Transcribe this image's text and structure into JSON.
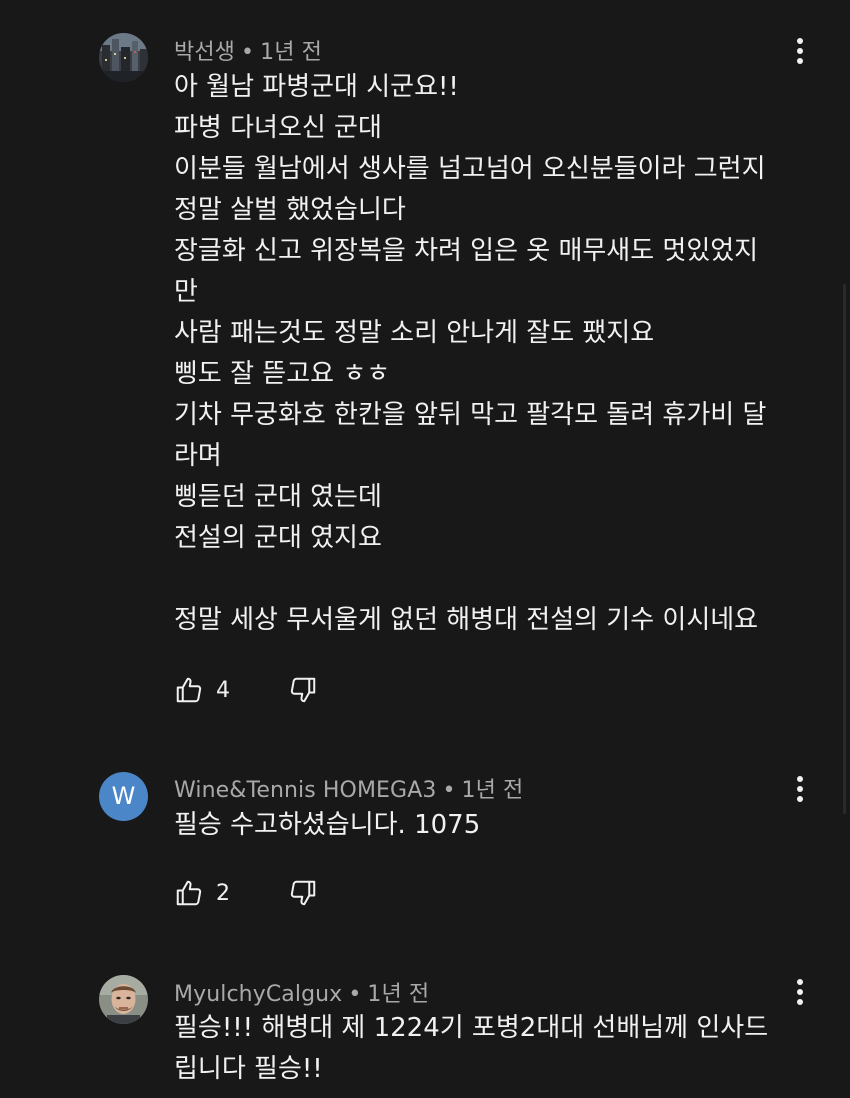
{
  "comments": [
    {
      "author": "박선생",
      "time": "1년 전",
      "avatar": {
        "type": "photo",
        "icon": "city-photo-avatar"
      },
      "lines": [
        "아 월남 파병군대 시군요!!",
        "파병 다녀오신 군대",
        "이분들 월남에서 생사를 넘고넘어 오신분들이라 그런지",
        "정말 살벌 했었습니다",
        "장글화 신고 위장복을 차려 입은 옷 매무새도 멋있었지",
        "만",
        "사람 패는것도 정말 소리 안나게 잘도 팼지요",
        "삥도 잘 뜯고요 ㅎㅎ",
        "기차 무궁화호 한칸을 앞뒤 막고 팔각모 돌려 휴가비 달",
        "라며",
        "삥듣던 군대 였는데",
        "전설의 군대 였지요",
        "",
        "정말 세상 무서울게 없던 해병대 전설의 기수 이시네요"
      ],
      "likes": "4"
    },
    {
      "author": "Wine&Tennis HOMEGA3",
      "time": "1년 전",
      "avatar": {
        "type": "letter",
        "letter": "W",
        "color": "#4a86c8"
      },
      "lines": [
        "필승 수고하셨습니다. 1075"
      ],
      "likes": "2"
    },
    {
      "author": "MyulchyCalgux",
      "time": "1년 전",
      "avatar": {
        "type": "photo",
        "icon": "face-photo-avatar"
      },
      "lines": [
        "필승!!! 해병대 제 1224기 포병2대대 선배님께 인사드",
        "립니다 필승!!"
      ],
      "likes": null
    }
  ],
  "separator": "•",
  "colors": {
    "background": "#181818",
    "text": "#f1f1f1",
    "meta": "#a9a9a9",
    "avatar_blue": "#4a86c8"
  }
}
